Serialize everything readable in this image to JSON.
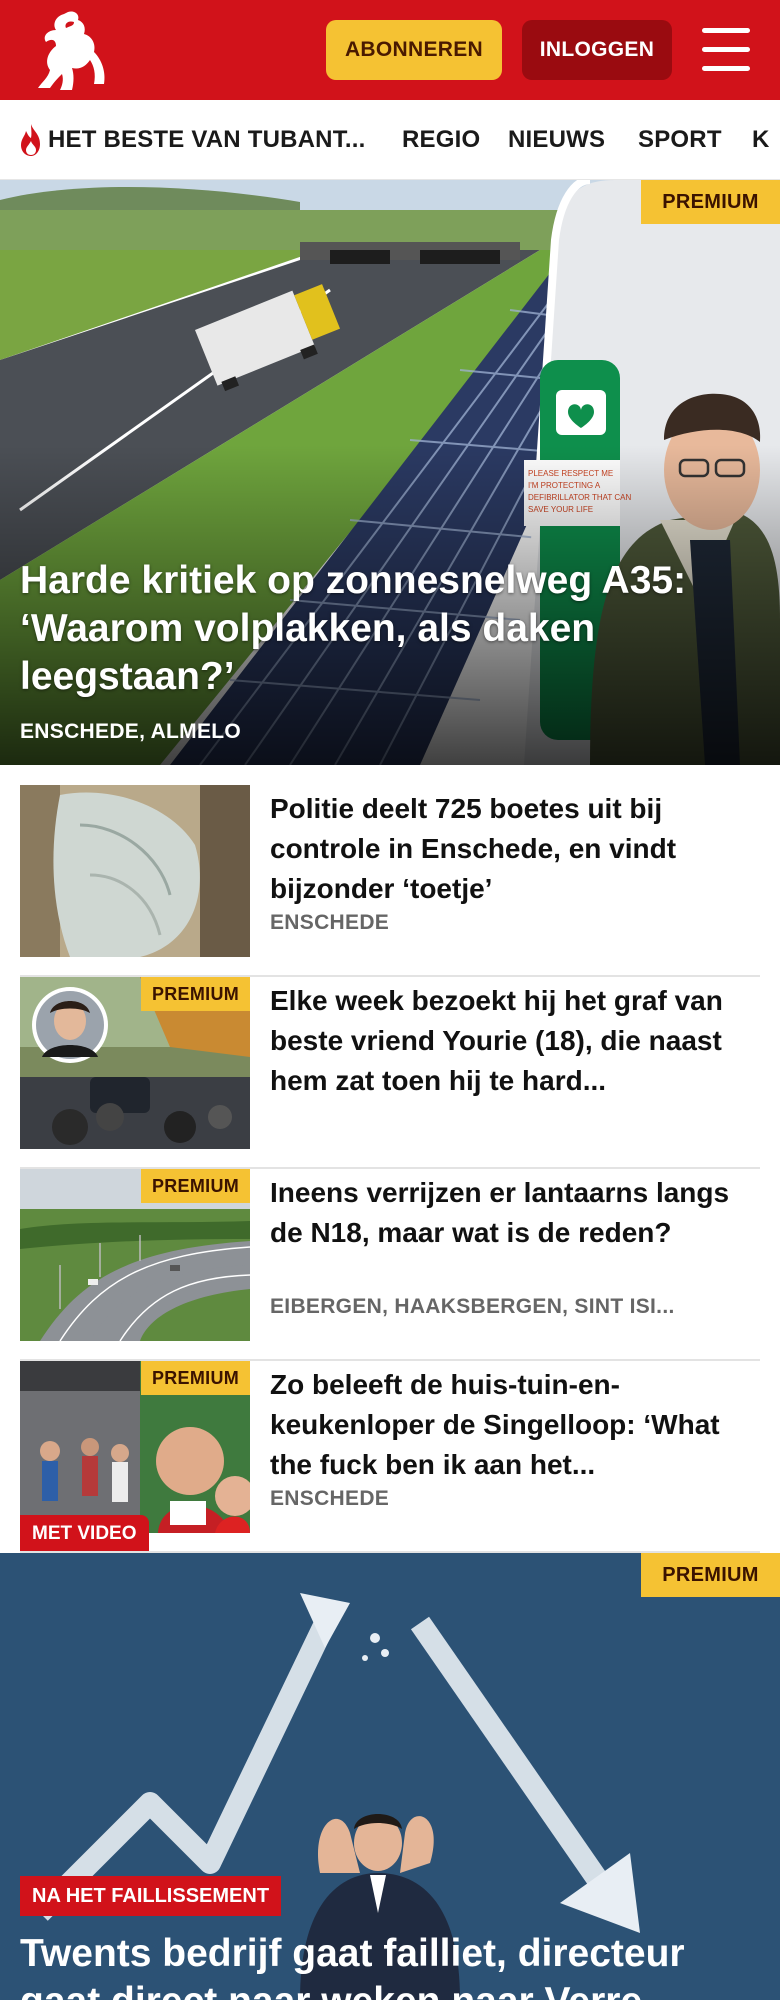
{
  "header": {
    "subscribe_label": "ABONNEREN",
    "login_label": "INLOGGEN",
    "logo_icon": "horse-logo-icon",
    "menu_icon": "hamburger-menu-icon",
    "brand_color": "#d1121a",
    "accent_color": "#f5c233"
  },
  "nav": {
    "items": [
      {
        "label": "HET BESTE VAN TUBANT...",
        "icon": "flame-icon"
      },
      {
        "label": "REGIO"
      },
      {
        "label": "NIEUWS"
      },
      {
        "label": "SPORT"
      },
      {
        "label": "K"
      }
    ]
  },
  "hero": {
    "badge": "PREMIUM",
    "title": "Harde kritiek op zonnesnelweg A35: ‘Waarom volplakken, als daken leegstaan?’",
    "location": "ENSCHEDE, ALMELO"
  },
  "articles": [
    {
      "title": "Politie deelt 725 boetes uit bij controle in Enschede, en vindt bijzonder ‘toetje’",
      "location": "ENSCHEDE",
      "premium": false
    },
    {
      "title": "Elke week bezoekt hij het graf van beste vriend Yourie (18), die naast hem zat toen hij te hard...",
      "location": "",
      "premium": true,
      "badge": "PREMIUM"
    },
    {
      "title": "Ineens verrijzen er lantaarns langs de N18, maar wat is de reden?",
      "location": "EIBERGEN, HAAKSBERGEN, SINT ISI...",
      "premium": true,
      "badge": "PREMIUM"
    },
    {
      "title": "Zo beleeft de huis-tuin-en-keukenloper de Singelloop: ‘What the fuck ben ik aan het...",
      "location": "ENSCHEDE",
      "premium": true,
      "badge": "PREMIUM",
      "video_label": "MET VIDEO"
    }
  ],
  "hero2": {
    "badge": "PREMIUM",
    "tag": "NA HET FAILLISSEMENT",
    "title": "Twents bedrijf gaat failliet, directeur gaat direct naar weken naar Verre..."
  }
}
